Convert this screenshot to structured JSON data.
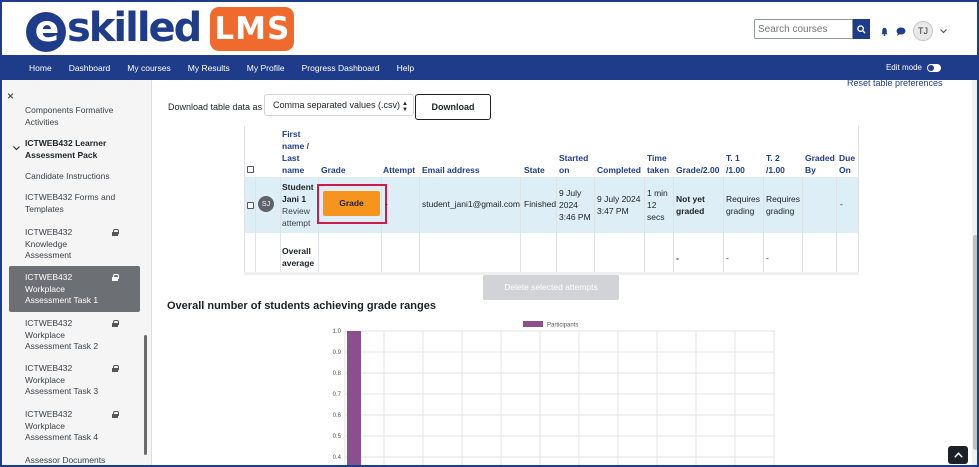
{
  "header": {
    "logo_word": "skilled",
    "logo_e": "e",
    "logo_badge": "LMS",
    "search_placeholder": "Search courses",
    "user_initials": "TJ",
    "icons": [
      "search-icon",
      "bell-icon",
      "chat-icon",
      "chevron-down-icon"
    ]
  },
  "nav": {
    "items": [
      "Home",
      "Dashboard",
      "My courses",
      "My Results",
      "My Profile",
      "Progress Dashboard",
      "Help"
    ],
    "edit_mode_label": "Edit mode"
  },
  "sidebar": {
    "close_glyph": "×",
    "items": [
      {
        "text": "Components Formative Activities",
        "locked": false
      },
      {
        "text": "ICTWEB432 Learner Assessment Pack",
        "section": true
      },
      {
        "text": "Candidate Instructions",
        "locked": false
      },
      {
        "text": "ICTWEB432 Forms and Templates",
        "locked": false
      },
      {
        "text": "ICTWEB432 Knowledge Assessment",
        "locked": true
      },
      {
        "text": "ICTWEB432 Workplace Assessment Task 1",
        "locked": true,
        "active": true
      },
      {
        "text": "ICTWEB432 Workplace Assessment Task 2",
        "locked": true
      },
      {
        "text": "ICTWEB432 Workplace Assessment Task 3",
        "locked": true
      },
      {
        "text": "ICTWEB432 Workplace Assessment Task 4",
        "locked": true
      },
      {
        "text": "Assessor Documents",
        "locked": false
      }
    ]
  },
  "main": {
    "reset_link": "Reset table preferences",
    "download_label": "Download table data as",
    "download_format": "Comma separated values (.csv)",
    "download_button": "Download",
    "table": {
      "headers": {
        "name": "First name / Last name",
        "grade": "Grade",
        "attempt": "Attempt",
        "email": "Email address",
        "state": "State",
        "started": "Started on",
        "completed": "Completed",
        "time": "Time taken",
        "grade_total": "Grade/2.00",
        "t1": "T. 1 /1.00",
        "t2": "T. 2 /1.00",
        "graded_by": "Graded By",
        "due": "Due On"
      },
      "row": {
        "initials": "SJ",
        "name": "Student Jani 1",
        "review": "Review attempt",
        "grade_button": "Grade",
        "attempt": "-",
        "email": "student_jani1@gmail.com",
        "state": "Finished",
        "started": "9 July 2024 3:46 PM",
        "completed": "9 July 2024 3:47 PM",
        "time": "1 min 12 secs",
        "grade_total": "Not yet graded",
        "t1": "Requires grading",
        "t2": "Requires grading",
        "due": "-"
      },
      "overall": {
        "label": "Overall average",
        "grade_total": "-",
        "t1": "-",
        "t2": "-"
      }
    },
    "delete_button": "Delete selected attempts",
    "chart_heading": "Overall number of students achieving grade ranges"
  },
  "chart_data": {
    "type": "bar",
    "series": [
      {
        "name": "Participants",
        "color": "#8c4f8e"
      }
    ],
    "y_ticks": [
      "1.0",
      "0.9",
      "0.8",
      "0.7",
      "0.6",
      "0.5",
      "0.4",
      "0.3"
    ],
    "visible_bar_value": 1.0,
    "ylim": [
      0,
      1.0
    ]
  }
}
